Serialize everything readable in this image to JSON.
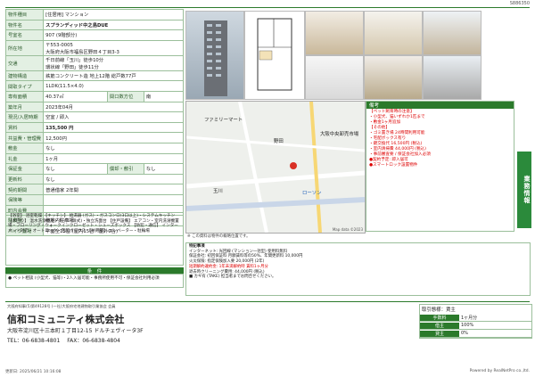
{
  "sheet_code": "S886350",
  "property": {
    "type_label": "物件種目",
    "type_value": "[住居用] マンション",
    "name_label": "物件名",
    "name": "スプランディッド中之島DUE",
    "room_label": "号室名",
    "room": "907 (9階部分)",
    "address_label": "所在地",
    "postal": "〒553-0005",
    "address": "大阪府大阪市福島区野田４丁目3-3",
    "access_label": "交通",
    "access": [
      "千日前線「玉川」徒歩10分",
      "環状線「野田」徒歩11分"
    ],
    "structure_label": "建物構造",
    "structure": "鉄筋コンクリート造 地上12階 総戸数77戸",
    "layout_label": "間取タイプ",
    "layout": "1LDK(11.5×4.0)",
    "area_label": "専有面積",
    "area": "40.37㎡",
    "aspect_label": "間口数方位",
    "aspect": "南",
    "built_label": "築年月",
    "built": "2023年04月",
    "status_label": "現況/入居時期",
    "status": "空室 / 即入",
    "rent_label": "賃料",
    "rent": "135,500 円",
    "fee_label": "共益費・管理費",
    "fee": "12,500円",
    "deposit_label": "敷金",
    "deposit": "なし",
    "key_label": "礼金",
    "key": "1ヶ月",
    "guarantee_label": "保証金",
    "guarantee": "なし",
    "amort_label": "償却・敷引",
    "amort": "なし",
    "renew_label": "更新料",
    "renew": "なし",
    "contract_label": "契約期間",
    "contract": "普通借家 2年間",
    "insurance_label": "保険等",
    "insurance": "",
    "town_label": "町内会費",
    "town": "",
    "parking_label": "駐車場",
    "parking": "敷地内駐車場",
    "bike_label": "バイク置場",
    "bike": "平面全15台 (屋内15台・屋外0台)"
  },
  "features": "【浴室】 浴室乾燥 【キッチン】 給湯器 (ガス) ・ガスコンロ(3口以上)・システムキッチン 【水回り】 温水洗浄便座・トイレ(洋式)・独立洗面台 【住戸設備】 エアコン・室内洗濯機置場・フローリング・ウォークインクローゼット・シューズボックス 【防犯・通信】 インターネット対応・オートロック・宅配ボックス 【共用部】 エレベーター・駐輪場",
  "conditions_header": "条　件",
  "conditions": "● ペット相談 (小型犬、猫等)・2人入居可能・事務所使用不可・保証会社利用必須",
  "remarks": {
    "header": "備考",
    "lines": [
      "【ペット飼育時の注意】",
      "・小型犬、猫いずれか1匹まで",
      "・敷金1ヶ月追加",
      "【その他】",
      "・ゴミ置き場 24時間利用可能",
      "・宅配ボックス有り",
      "・鍵交換代 16,500円 (税込)",
      "・室内清掃費 44,000円 (税込)",
      "・事前審査要 / 保証会社加入必須",
      "●契約予定: 即入居可",
      "●スマートロック設置物件"
    ]
  },
  "side_tab": "業務情報",
  "map": {
    "copyright": "Map data ©2023",
    "labels": [
      "野田",
      "玉川",
      "大阪中央卸売市場",
      "ローソン",
      "ファミリーマート"
    ],
    "note": "※ この資料は物件の概略位置です。"
  },
  "notes_header": "特記事項",
  "notes": [
    "インターネット: 光回線 (マンション一括型) 使用料無料",
    "保証会社: 初回保証料 月額賃料等の50%、年間更新料 10,000円",
    "火災保険: 指定保険加入要 20,000円 (2年)",
    "短期解約違約金: 1年未満解約時 賃料1ヶ月分",
    "退去時クリーニング費用: 44,000円 (税込)",
    "■ カギ有 (TAKE) 担当者までお問合せください。"
  ],
  "company": {
    "license": "大阪府知事(5)第49128号 (一社)大阪府宅地建物取引業協会 会員",
    "name": "信和コミュニティ株式会社",
    "address": "大阪市淀川区十三本町１丁目12-15 ドルチェヴィータ3F",
    "tel": "TEL：06-6838-4801",
    "fax": "FAX：06-6838-4804"
  },
  "trade": {
    "title": "取引態様：賃主",
    "rows": [
      {
        "k": "手数料",
        "v": "1ヶ月分"
      },
      {
        "k": "借主",
        "v": "100%"
      },
      {
        "k": "貸主",
        "v": "0%"
      }
    ]
  },
  "footer": {
    "left": "更新日: 2025/06/21 10:16:08",
    "right": "Powered by RealNetPro co.,ltd."
  }
}
